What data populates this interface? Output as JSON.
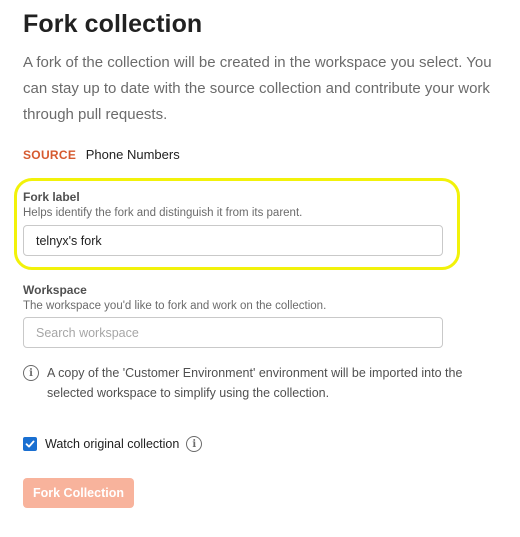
{
  "title": "Fork collection",
  "description": "A fork of the collection will be created in the workspace you select. You can stay up to date with the source collection and contribute your work through pull requests.",
  "source": {
    "tag": "SOURCE",
    "name": "Phone Numbers"
  },
  "fork_label": {
    "label": "Fork label",
    "help": "Helps identify the fork and distinguish it from its parent.",
    "value": "telnyx's fork"
  },
  "workspace": {
    "label": "Workspace",
    "help": "The workspace you'd like to fork and work on the collection.",
    "placeholder": "Search workspace",
    "value": ""
  },
  "info": {
    "icon": "info-icon",
    "text": "A copy of the 'Customer Environment' environment will be imported into the selected workspace to simplify using the collection."
  },
  "watch": {
    "checked": true,
    "label": "Watch original collection",
    "icon": "info-icon"
  },
  "fork_button_label": "Fork Collection",
  "colors": {
    "source_tag": "#d65a2f",
    "highlight": "#f2f20a",
    "checkbox": "#1a6fd1",
    "button_disabled": "#f8b39c"
  }
}
